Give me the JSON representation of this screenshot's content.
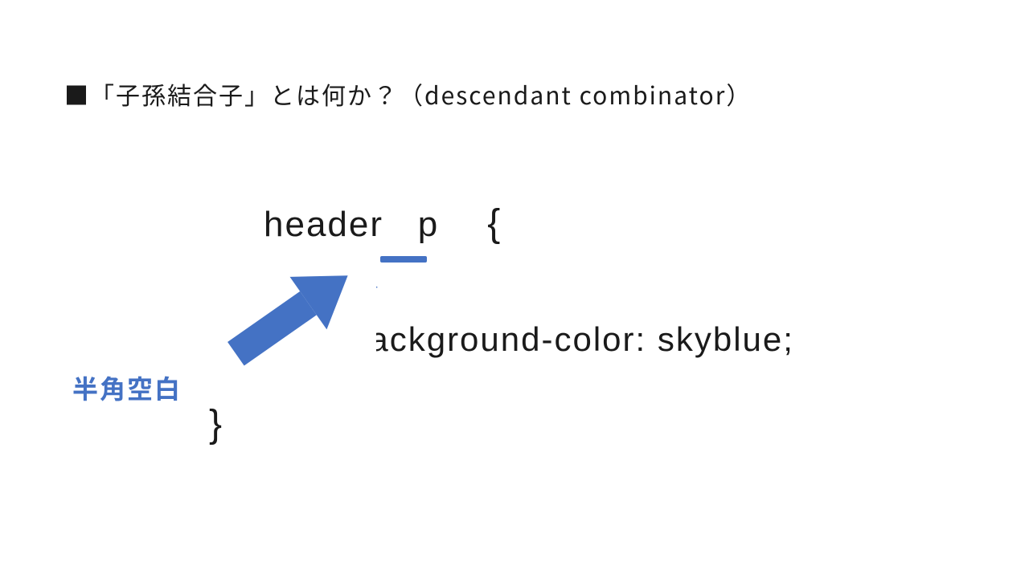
{
  "title": "■「子孫結合子」とは何か？（descendant combinator）",
  "code": {
    "selector_a": "header",
    "gap": "   ",
    "selector_b": "p",
    "open_brace": "{",
    "declaration": "background-color: skyblue;",
    "close_brace": "}"
  },
  "annotation": "半角空白",
  "colors": {
    "accent": "#4472C4"
  }
}
